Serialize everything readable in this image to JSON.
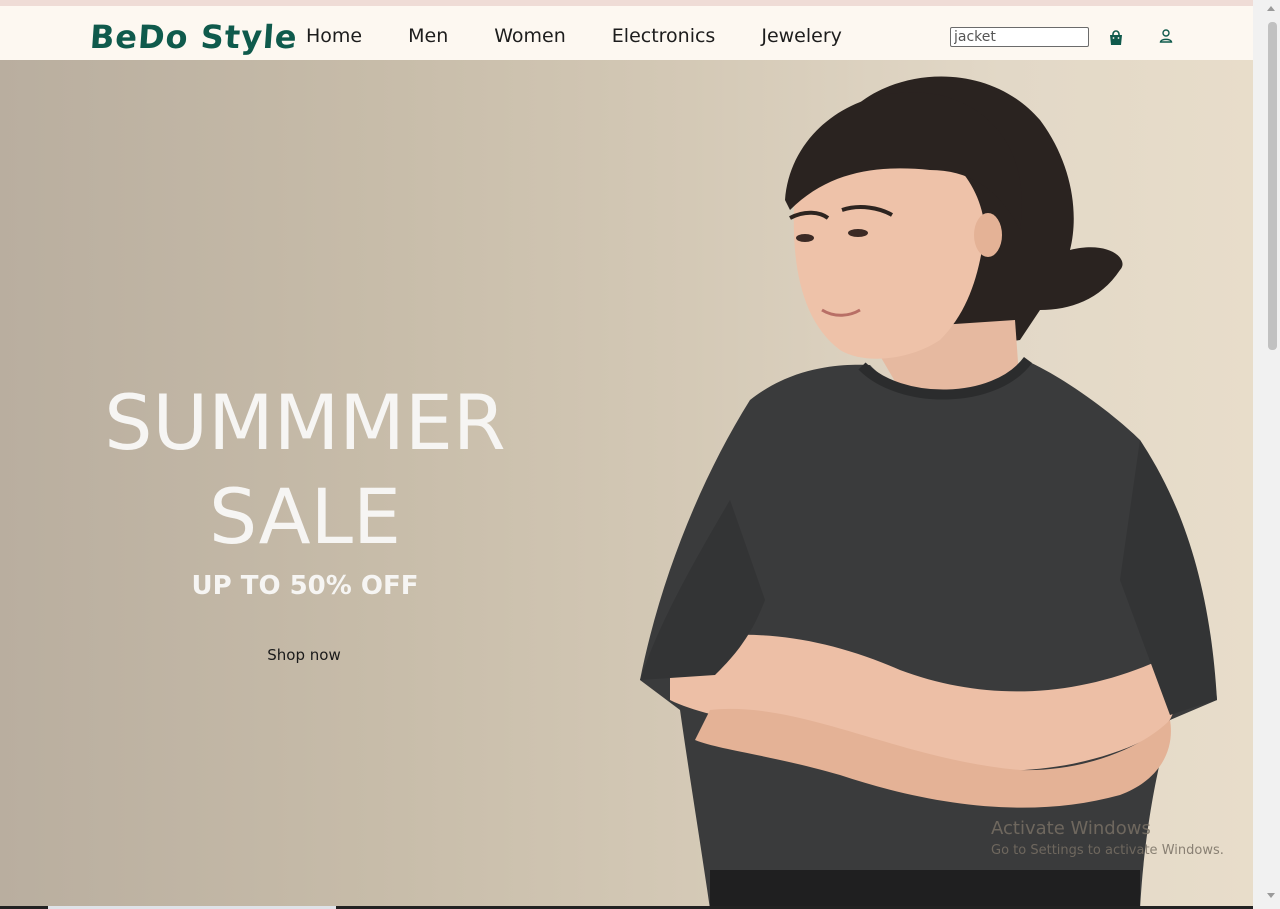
{
  "brand": {
    "name": "BeDo Style",
    "color": "#0f5a4c"
  },
  "nav": {
    "links": [
      {
        "label": "Home"
      },
      {
        "label": "Men"
      },
      {
        "label": "Women"
      },
      {
        "label": "Electronics"
      },
      {
        "label": "Jewelery"
      }
    ]
  },
  "search": {
    "value": "jacket",
    "placeholder": "jacket"
  },
  "icons": {
    "cart": "shopping-bag-icon",
    "account": "user-icon"
  },
  "hero": {
    "title_line1": "SUMMMER",
    "title_line2": "SALE",
    "subtitle": "UP TO 50% OFF",
    "cta": "Shop now"
  },
  "watermark": {
    "line1": "Activate Windows",
    "line2": "Go to Settings to activate Windows."
  }
}
